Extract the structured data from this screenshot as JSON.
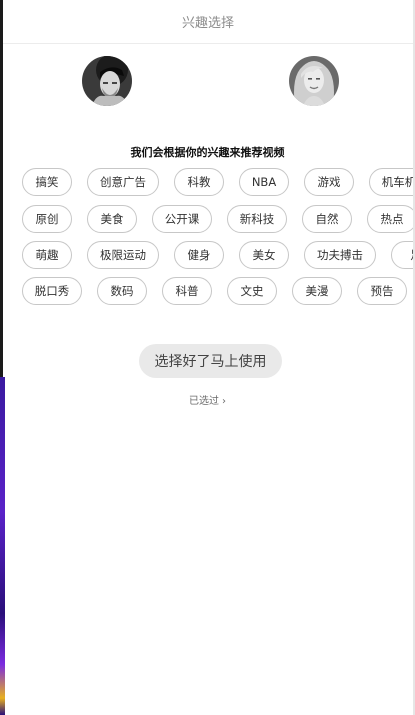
{
  "header": {
    "title": "兴趣选择"
  },
  "subtitle": "我们会根据你的兴趣来推荐视频",
  "tag_rows": [
    [
      "搞笑",
      "创意广告",
      "科教",
      "NBA",
      "游戏",
      "机车机"
    ],
    [
      "原创",
      "美食",
      "公开课",
      "新科技",
      "自然",
      "热点"
    ],
    [
      "萌趣",
      "极限运动",
      "健身",
      "美女",
      "功夫搏击",
      "足"
    ],
    [
      "脱口秀",
      "数码",
      "科普",
      "文史",
      "美漫",
      "预告"
    ]
  ],
  "primary_button": "选择好了马上使用",
  "skip": {
    "label": "已选过",
    "chevron": "›"
  },
  "icons": {
    "left_avatar": "avatar-man-icon",
    "right_avatar": "avatar-woman-icon",
    "skip_chevron": "chevron-right-icon"
  },
  "colors": {
    "tag_border": "#c7c7c7",
    "button_bg": "#e9e9e9",
    "header_text": "#8c8c8c"
  }
}
